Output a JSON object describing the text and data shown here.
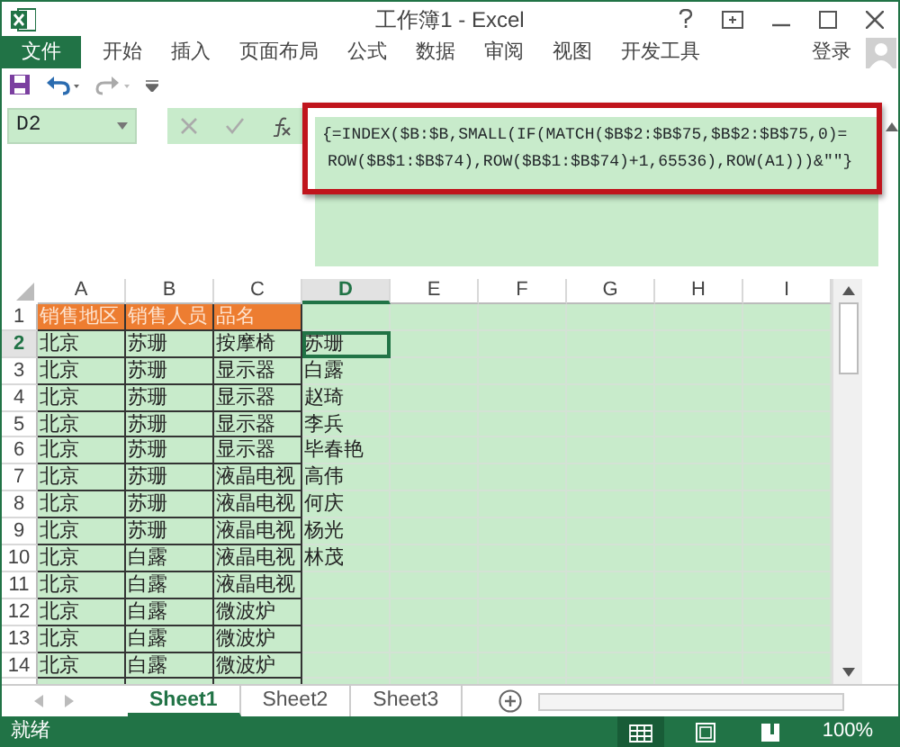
{
  "window": {
    "title": "工作簿1 - Excel"
  },
  "ribbon_tabs": [
    {
      "label": "文件",
      "kind": "file"
    },
    {
      "label": "开始",
      "kind": "tab"
    },
    {
      "label": "插入",
      "kind": "tab"
    },
    {
      "label": "页面布局",
      "kind": "tab"
    },
    {
      "label": "公式",
      "kind": "tab"
    },
    {
      "label": "数据",
      "kind": "tab"
    },
    {
      "label": "审阅",
      "kind": "tab"
    },
    {
      "label": "视图",
      "kind": "tab"
    },
    {
      "label": "开发工具",
      "kind": "tab"
    }
  ],
  "account": {
    "label": "登录"
  },
  "formula_bar": {
    "name_box": "D2",
    "lines": [
      "{=INDEX($B:$B,SMALL(IF(MATCH($B$2:$B$75,$B$2:$B$75,0)=",
      "ROW($B$1:$B$74),ROW($B$1:$B$74)+1,65536),ROW(A1)))&\"\"}"
    ]
  },
  "columns": [
    {
      "label": "A",
      "selected": false
    },
    {
      "label": "B",
      "selected": false
    },
    {
      "label": "C",
      "selected": false
    },
    {
      "label": "D",
      "selected": true
    },
    {
      "label": "E",
      "selected": false
    },
    {
      "label": "F",
      "selected": false
    },
    {
      "label": "G",
      "selected": false
    },
    {
      "label": "H",
      "selected": false
    },
    {
      "label": "I",
      "selected": false
    }
  ],
  "rows": [
    {
      "number": "1",
      "kind": "header",
      "selected": false,
      "cells": [
        "销售地区",
        "销售人员",
        "品名"
      ]
    },
    {
      "number": "2",
      "kind": "data",
      "selected": true,
      "cells": [
        "北京",
        "苏珊",
        "按摩椅",
        "苏珊"
      ]
    },
    {
      "number": "3",
      "kind": "data",
      "selected": false,
      "cells": [
        "北京",
        "苏珊",
        "显示器",
        "白露"
      ]
    },
    {
      "number": "4",
      "kind": "data",
      "selected": false,
      "cells": [
        "北京",
        "苏珊",
        "显示器",
        "赵琦"
      ]
    },
    {
      "number": "5",
      "kind": "data",
      "selected": false,
      "cells": [
        "北京",
        "苏珊",
        "显示器",
        "李兵"
      ]
    },
    {
      "number": "6",
      "kind": "data",
      "selected": false,
      "cells": [
        "北京",
        "苏珊",
        "显示器",
        "毕春艳"
      ]
    },
    {
      "number": "7",
      "kind": "data",
      "selected": false,
      "cells": [
        "北京",
        "苏珊",
        "液晶电视",
        "高伟"
      ]
    },
    {
      "number": "8",
      "kind": "data",
      "selected": false,
      "cells": [
        "北京",
        "苏珊",
        "液晶电视",
        "何庆"
      ]
    },
    {
      "number": "9",
      "kind": "data",
      "selected": false,
      "cells": [
        "北京",
        "苏珊",
        "液晶电视",
        "杨光"
      ]
    },
    {
      "number": "10",
      "kind": "data",
      "selected": false,
      "cells": [
        "北京",
        "白露",
        "液晶电视",
        "林茂"
      ]
    },
    {
      "number": "11",
      "kind": "data",
      "selected": false,
      "cells": [
        "北京",
        "白露",
        "液晶电视"
      ]
    },
    {
      "number": "12",
      "kind": "data",
      "selected": false,
      "cells": [
        "北京",
        "白露",
        "微波炉"
      ]
    },
    {
      "number": "13",
      "kind": "data",
      "selected": false,
      "cells": [
        "北京",
        "白露",
        "微波炉"
      ]
    },
    {
      "number": "14",
      "kind": "data",
      "selected": false,
      "cells": [
        "北京",
        "白露",
        "微波炉"
      ]
    }
  ],
  "sheet_tabs": [
    {
      "label": "Sheet1",
      "selected": true
    },
    {
      "label": "Sheet2",
      "selected": false
    },
    {
      "label": "Sheet3",
      "selected": false
    }
  ],
  "status_bar": {
    "text": "就绪",
    "zoom": "100%",
    "views": [
      {
        "kind": "normal",
        "selected": true
      },
      {
        "kind": "layout",
        "selected": false
      },
      {
        "kind": "break",
        "selected": false
      }
    ]
  }
}
